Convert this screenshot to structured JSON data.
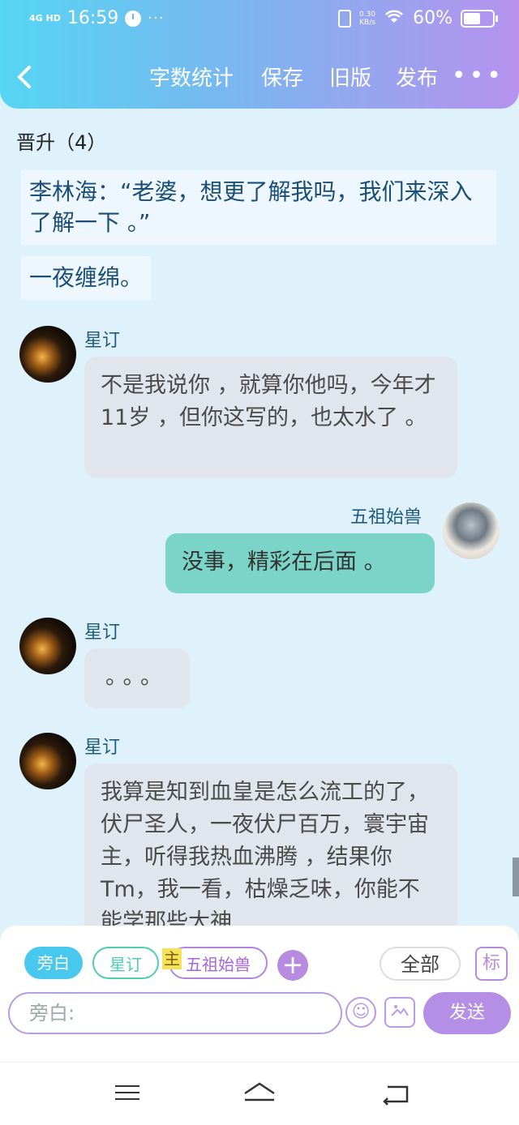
{
  "status_bar": {
    "signal": "4G HD",
    "time": "16:59",
    "more": "···",
    "net_speed": "0.30\nKB/s",
    "battery": "60%"
  },
  "toolbar": {
    "back": "<",
    "word_count": "字数统计",
    "save": "保存",
    "old_version": "旧版",
    "publish": "发布",
    "more": "•••"
  },
  "chapter_title": "晋升（4）",
  "narration": [
    "李林海：“老婆，想更了解我吗，我们来深入了解一下 。”",
    "一夜缠绵。"
  ],
  "messages": [
    {
      "sender": "星订",
      "text": "不是我说你 ，就算你他吗，今年才11岁 ，但你这写的，也太水了 。"
    },
    {
      "sender": "五祖始兽",
      "text": "没事，精彩在后面 。"
    },
    {
      "sender": "星订",
      "text": "。。。"
    },
    {
      "sender": "星订",
      "text": "我算是知到血皇是怎么流工的了，伏尸圣人，一夜伏尸百万，寰宇宙主，听得我热血沸腾 ，结果你Tm，我一看，枯燥乏味，你能不能学那些大神"
    }
  ],
  "roles": {
    "narration": "旁白",
    "xingding": "星订",
    "main_tag": "主",
    "wuzu": "五祖始兽",
    "add": "+",
    "all": "全部",
    "mark": "标"
  },
  "composer": {
    "placeholder": "旁白:",
    "send": "发送"
  },
  "colors": {
    "header_start": "#55d6f2",
    "header_end": "#b792ee",
    "my_bubble": "#7ad5c8",
    "accent": "#b58fe6"
  }
}
